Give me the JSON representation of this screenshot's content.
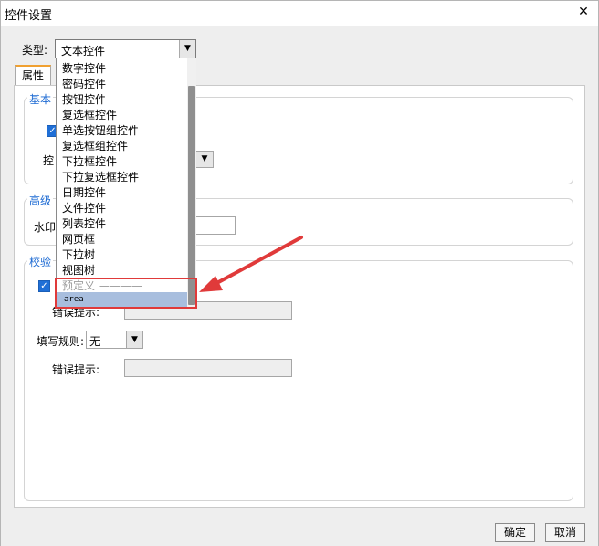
{
  "window": {
    "title": "控件设置",
    "close_glyph": "✕"
  },
  "type_field": {
    "label": "类型:",
    "value": "文本控件"
  },
  "tabs": [
    {
      "label": "属性"
    }
  ],
  "groups": {
    "basic": {
      "title": "基本属性",
      "visible_title": "基本",
      "control_label": "控"
    },
    "advanced": {
      "title": "高级",
      "watermark_label": "水印"
    },
    "validation": {
      "title": "校验",
      "error_label": "错误提示:",
      "rule_label": "填写规则:",
      "rule_value": "无",
      "error_label_2": "错误提示:"
    }
  },
  "dropdown": {
    "items": [
      "数字控件",
      "密码控件",
      "按钮控件",
      "复选框控件",
      "单选按钮组控件",
      "复选框组控件",
      "下拉框控件",
      "下拉复选框控件",
      "日期控件",
      "文件控件",
      "列表控件",
      "网页框",
      "下拉树",
      "视图树"
    ],
    "separator": "预定义 ————",
    "selected": "area"
  },
  "buttons": {
    "ok": "确定",
    "cancel": "取消"
  },
  "colors": {
    "accent": "#1e6bd3",
    "highlight": "#e03a3a",
    "selection": "#a8bede",
    "tab_accent": "#f0a030"
  }
}
